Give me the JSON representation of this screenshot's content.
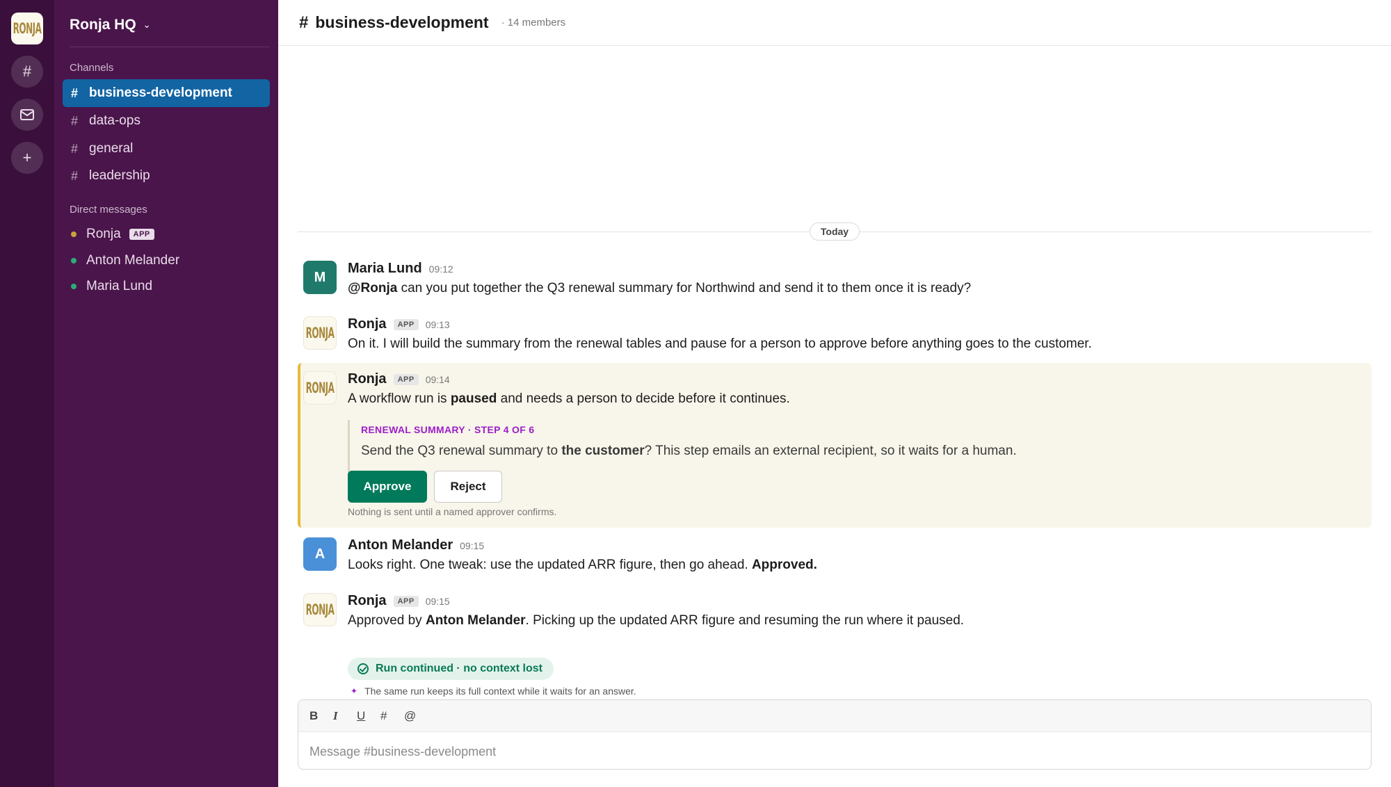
{
  "workspace": {
    "name": "Ronja HQ",
    "logo_text": "RONJA"
  },
  "rail": {
    "icons": [
      "channels-icon",
      "inbox-icon",
      "add-icon"
    ]
  },
  "sidebar": {
    "channels_heading": "Channels",
    "channels": [
      {
        "label": "business-development",
        "active": true
      },
      {
        "label": "data-ops"
      },
      {
        "label": "general"
      },
      {
        "label": "leadership"
      }
    ],
    "dms_heading": "Direct messages",
    "dms": [
      {
        "label": "Ronja",
        "badge": "APP",
        "status_color": "#c9a43a"
      },
      {
        "label": "Anton Melander",
        "status_color": "#2bac76"
      },
      {
        "label": "Maria Lund",
        "status_color": "#2bac76"
      }
    ]
  },
  "header": {
    "channel": "business-development",
    "members": "· 14 members"
  },
  "day_divider": "Today",
  "messages": [
    {
      "author": "Maria Lund",
      "avatar": "M",
      "avatar_color": "#1f7a6b",
      "time": "09:12",
      "mention": "@Ronja",
      "text": " can you put together the Q3 renewal summary for Northwind and send it to them once it is ready?"
    },
    {
      "author": "Ronja",
      "badge": "APP",
      "time": "09:13",
      "text": "On it. I will build the summary from the renewal tables and pause for a person to approve before anything goes to the customer."
    },
    {
      "author": "Ronja",
      "badge": "APP",
      "time": "09:14",
      "text_pre": "A workflow run is ",
      "text_bold": "paused",
      "text_post": " and needs a person to decide before it continues.",
      "step_label": "RENEWAL SUMMARY · STEP 4 OF 6",
      "question_pre": "Send the Q3 renewal summary to ",
      "question_bold": "the customer",
      "question_post": "? This step emails an external recipient, so it waits for a human.",
      "approve_label": "Approve",
      "reject_label": "Reject",
      "note": "Nothing is sent until a named approver confirms."
    },
    {
      "author": "Anton Melander",
      "avatar": "A",
      "avatar_color": "#4a90d9",
      "time": "09:15",
      "text": "Looks right. One tweak: use the updated ARR figure, then go ahead. ",
      "text_bold": "Approved."
    },
    {
      "author": "Ronja",
      "badge": "APP",
      "time": "09:15",
      "text_pre": "Approved by ",
      "text_bold": "Anton Melander",
      "text_post": ". Picking up the updated ARR figure and resuming the run where it paused.",
      "status": "Run continued · no context lost",
      "hint": "The same run keeps its full context while it waits for an answer."
    }
  ],
  "composer": {
    "toolbar": [
      "B",
      "I",
      "U",
      "#",
      "@"
    ],
    "placeholder": "Message #business-development"
  }
}
